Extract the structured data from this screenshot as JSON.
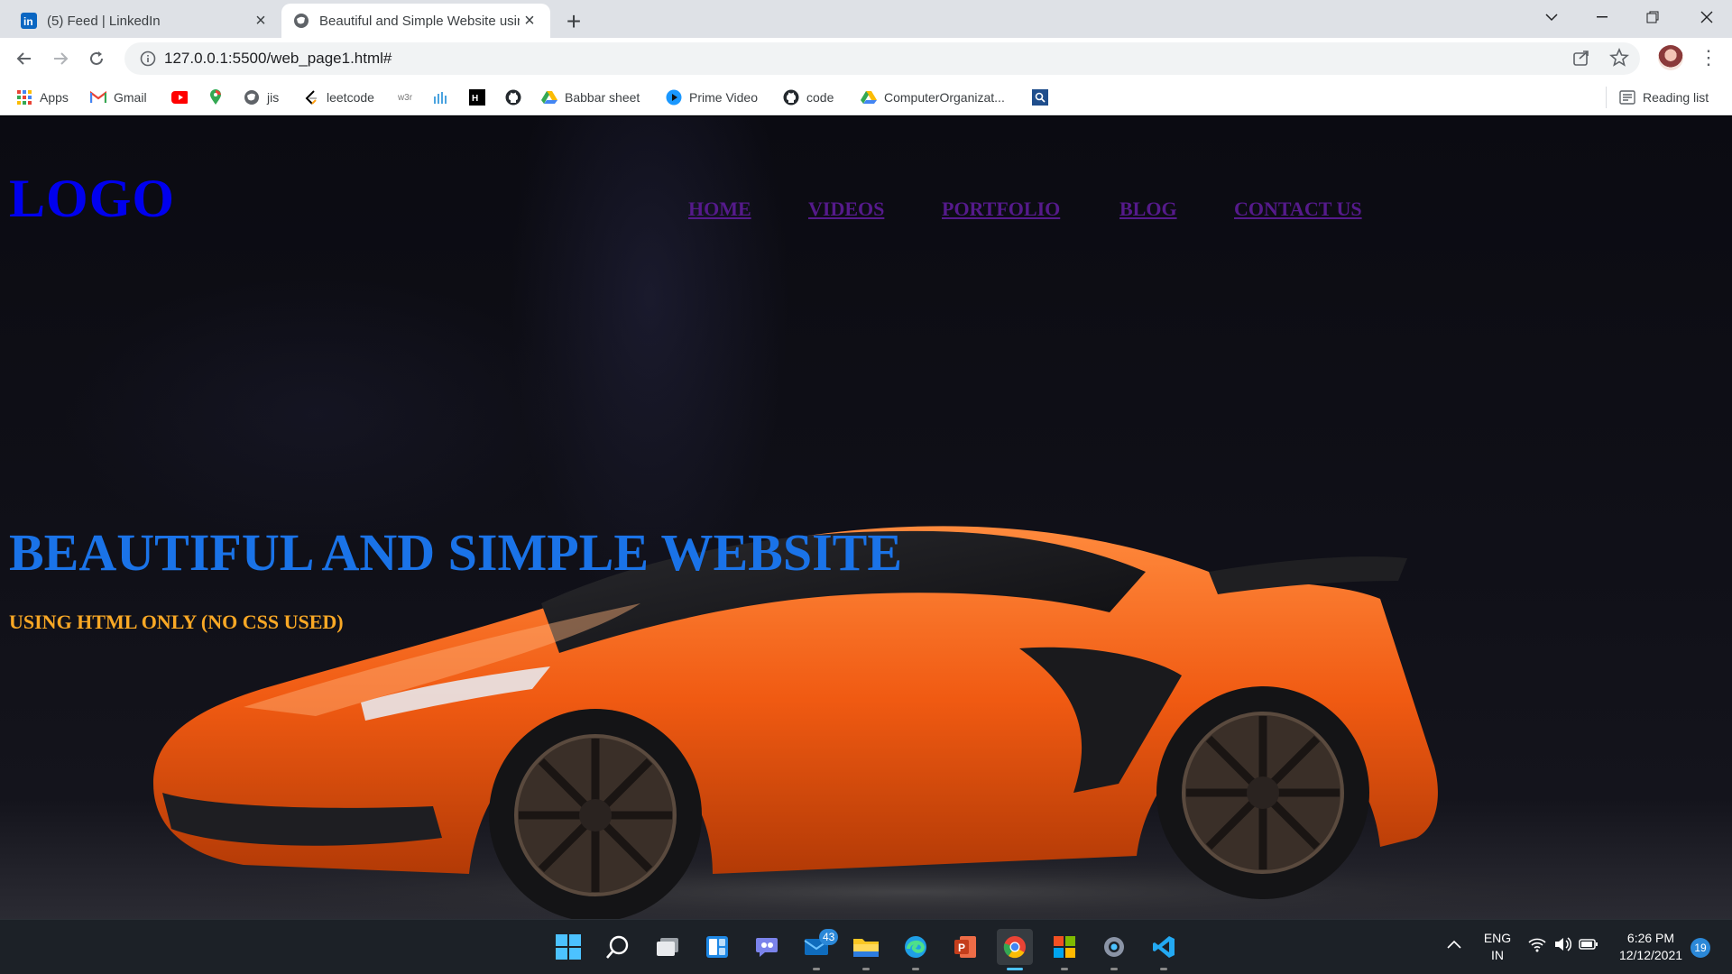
{
  "browser": {
    "tabs": [
      {
        "title": "(5) Feed | LinkedIn",
        "icon": "linkedin-icon",
        "active": false
      },
      {
        "title": "Beautiful and Simple Website using HTML",
        "icon": "globe-icon",
        "active": true
      }
    ],
    "url": "127.0.0.1:5500/web_page1.html#",
    "bookmarks": [
      {
        "label": "Apps",
        "icon": "apps-grid-icon"
      },
      {
        "label": "Gmail",
        "icon": "gmail-icon"
      },
      {
        "label": "",
        "icon": "youtube-icon"
      },
      {
        "label": "",
        "icon": "maps-icon"
      },
      {
        "label": "jis",
        "icon": "globe-icon"
      },
      {
        "label": "leetcode",
        "icon": "leetcode-icon"
      },
      {
        "label": "",
        "icon": "w3schools-icon"
      },
      {
        "label": "",
        "icon": "chart-bars-icon"
      },
      {
        "label": "",
        "icon": "hackerrank-icon"
      },
      {
        "label": "",
        "icon": "github-icon"
      },
      {
        "label": "Babbar sheet",
        "icon": "google-drive-icon"
      },
      {
        "label": "Prime Video",
        "icon": "prime-video-icon"
      },
      {
        "label": "code",
        "icon": "github-icon"
      },
      {
        "label": "ComputerOrganizat...",
        "icon": "google-drive-icon"
      },
      {
        "label": "",
        "icon": "search-box-icon"
      }
    ],
    "reading_list": "Reading list"
  },
  "page": {
    "logo": "LOGO",
    "nav": [
      "HOME",
      "VIDEOS",
      "PORTFOLIO",
      "BLOG",
      "CONTACT US"
    ],
    "hero_title": "BEAUTIFUL AND SIMPLE WEBSITE",
    "hero_subtitle": "USING HTML ONLY (NO CSS USED)"
  },
  "taskbar": {
    "mail_badge": "43",
    "lang_line1": "ENG",
    "lang_line2": "IN",
    "time": "6:26 PM",
    "date": "12/12/2021",
    "notification_count": "19"
  }
}
